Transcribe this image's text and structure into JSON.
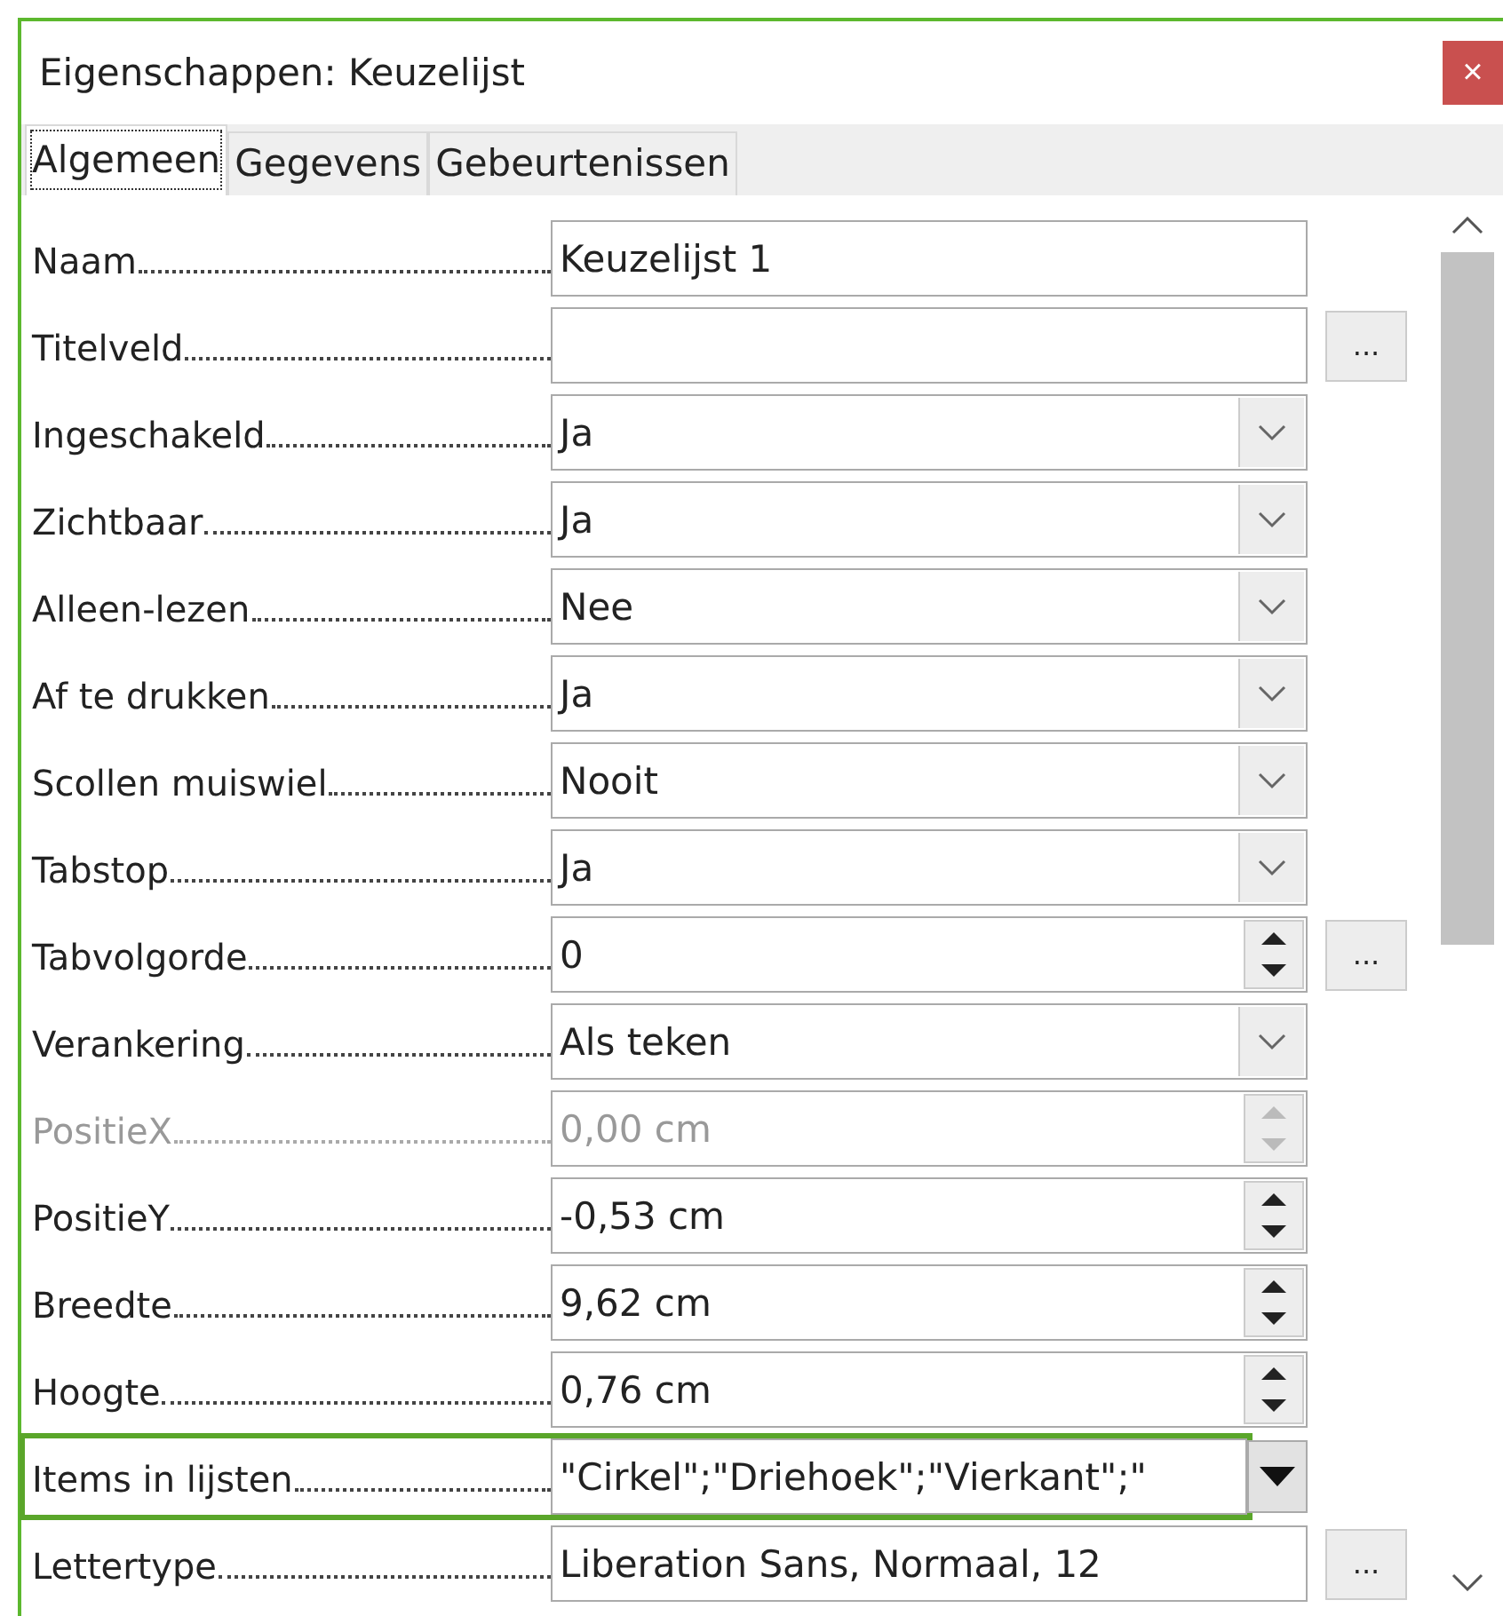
{
  "window": {
    "title": "Eigenschappen: Keuzelijst",
    "close": "×"
  },
  "tabs": [
    {
      "label": "Algemeen",
      "selected": true
    },
    {
      "label": "Gegevens",
      "selected": false
    },
    {
      "label": "Gebeurtenissen",
      "selected": false
    }
  ],
  "properties": [
    {
      "label": "Naam",
      "kind": "text",
      "value": "Keuzelijst 1",
      "disabled": false,
      "highlighted": false
    },
    {
      "label": "Titelveld",
      "kind": "text",
      "button": "...",
      "disabled": false,
      "highlighted": false
    },
    {
      "label": "Ingeschakeld",
      "kind": "select",
      "value": "Ja",
      "disabled": false,
      "highlighted": false
    },
    {
      "label": "Zichtbaar",
      "kind": "select",
      "value": "Ja",
      "disabled": false,
      "highlighted": false
    },
    {
      "label": "Alleen-lezen",
      "kind": "select",
      "value": "Nee",
      "disabled": false,
      "highlighted": false
    },
    {
      "label": "Af te drukken",
      "kind": "select",
      "value": "Ja",
      "disabled": false,
      "highlighted": false
    },
    {
      "label": "Scollen muiswiel",
      "kind": "select",
      "value": "Nooit",
      "disabled": false,
      "highlighted": false
    },
    {
      "label": "Tabstop",
      "kind": "select",
      "value": "Ja",
      "disabled": false,
      "highlighted": false
    },
    {
      "label": "Tabvolgorde",
      "kind": "spin",
      "value": "0",
      "button": "...",
      "disabled": false,
      "highlighted": false
    },
    {
      "label": "Verankering",
      "kind": "select",
      "value": "Als teken",
      "disabled": false,
      "highlighted": false
    },
    {
      "label": "PositieX",
      "kind": "spin",
      "value": "0,00 cm",
      "disabled": true,
      "highlighted": false
    },
    {
      "label": "PositieY",
      "kind": "spin",
      "value": "-0,53 cm",
      "disabled": false,
      "highlighted": false
    },
    {
      "label": "Breedte",
      "kind": "spin",
      "value": "9,62 cm",
      "disabled": false,
      "highlighted": false
    },
    {
      "label": "Hoogte",
      "kind": "spin",
      "value": "0,76 cm",
      "disabled": false,
      "highlighted": false
    },
    {
      "label": "Items in lijsten",
      "kind": "list",
      "value": "\"Cirkel\";\"Driehoek\";\"Vierkant\";\"",
      "disabled": false,
      "highlighted": true
    },
    {
      "label": "Lettertype",
      "kind": "text",
      "value": "Liberation Sans, Normaal, 12",
      "button": "...",
      "disabled": false,
      "highlighted": false
    }
  ]
}
